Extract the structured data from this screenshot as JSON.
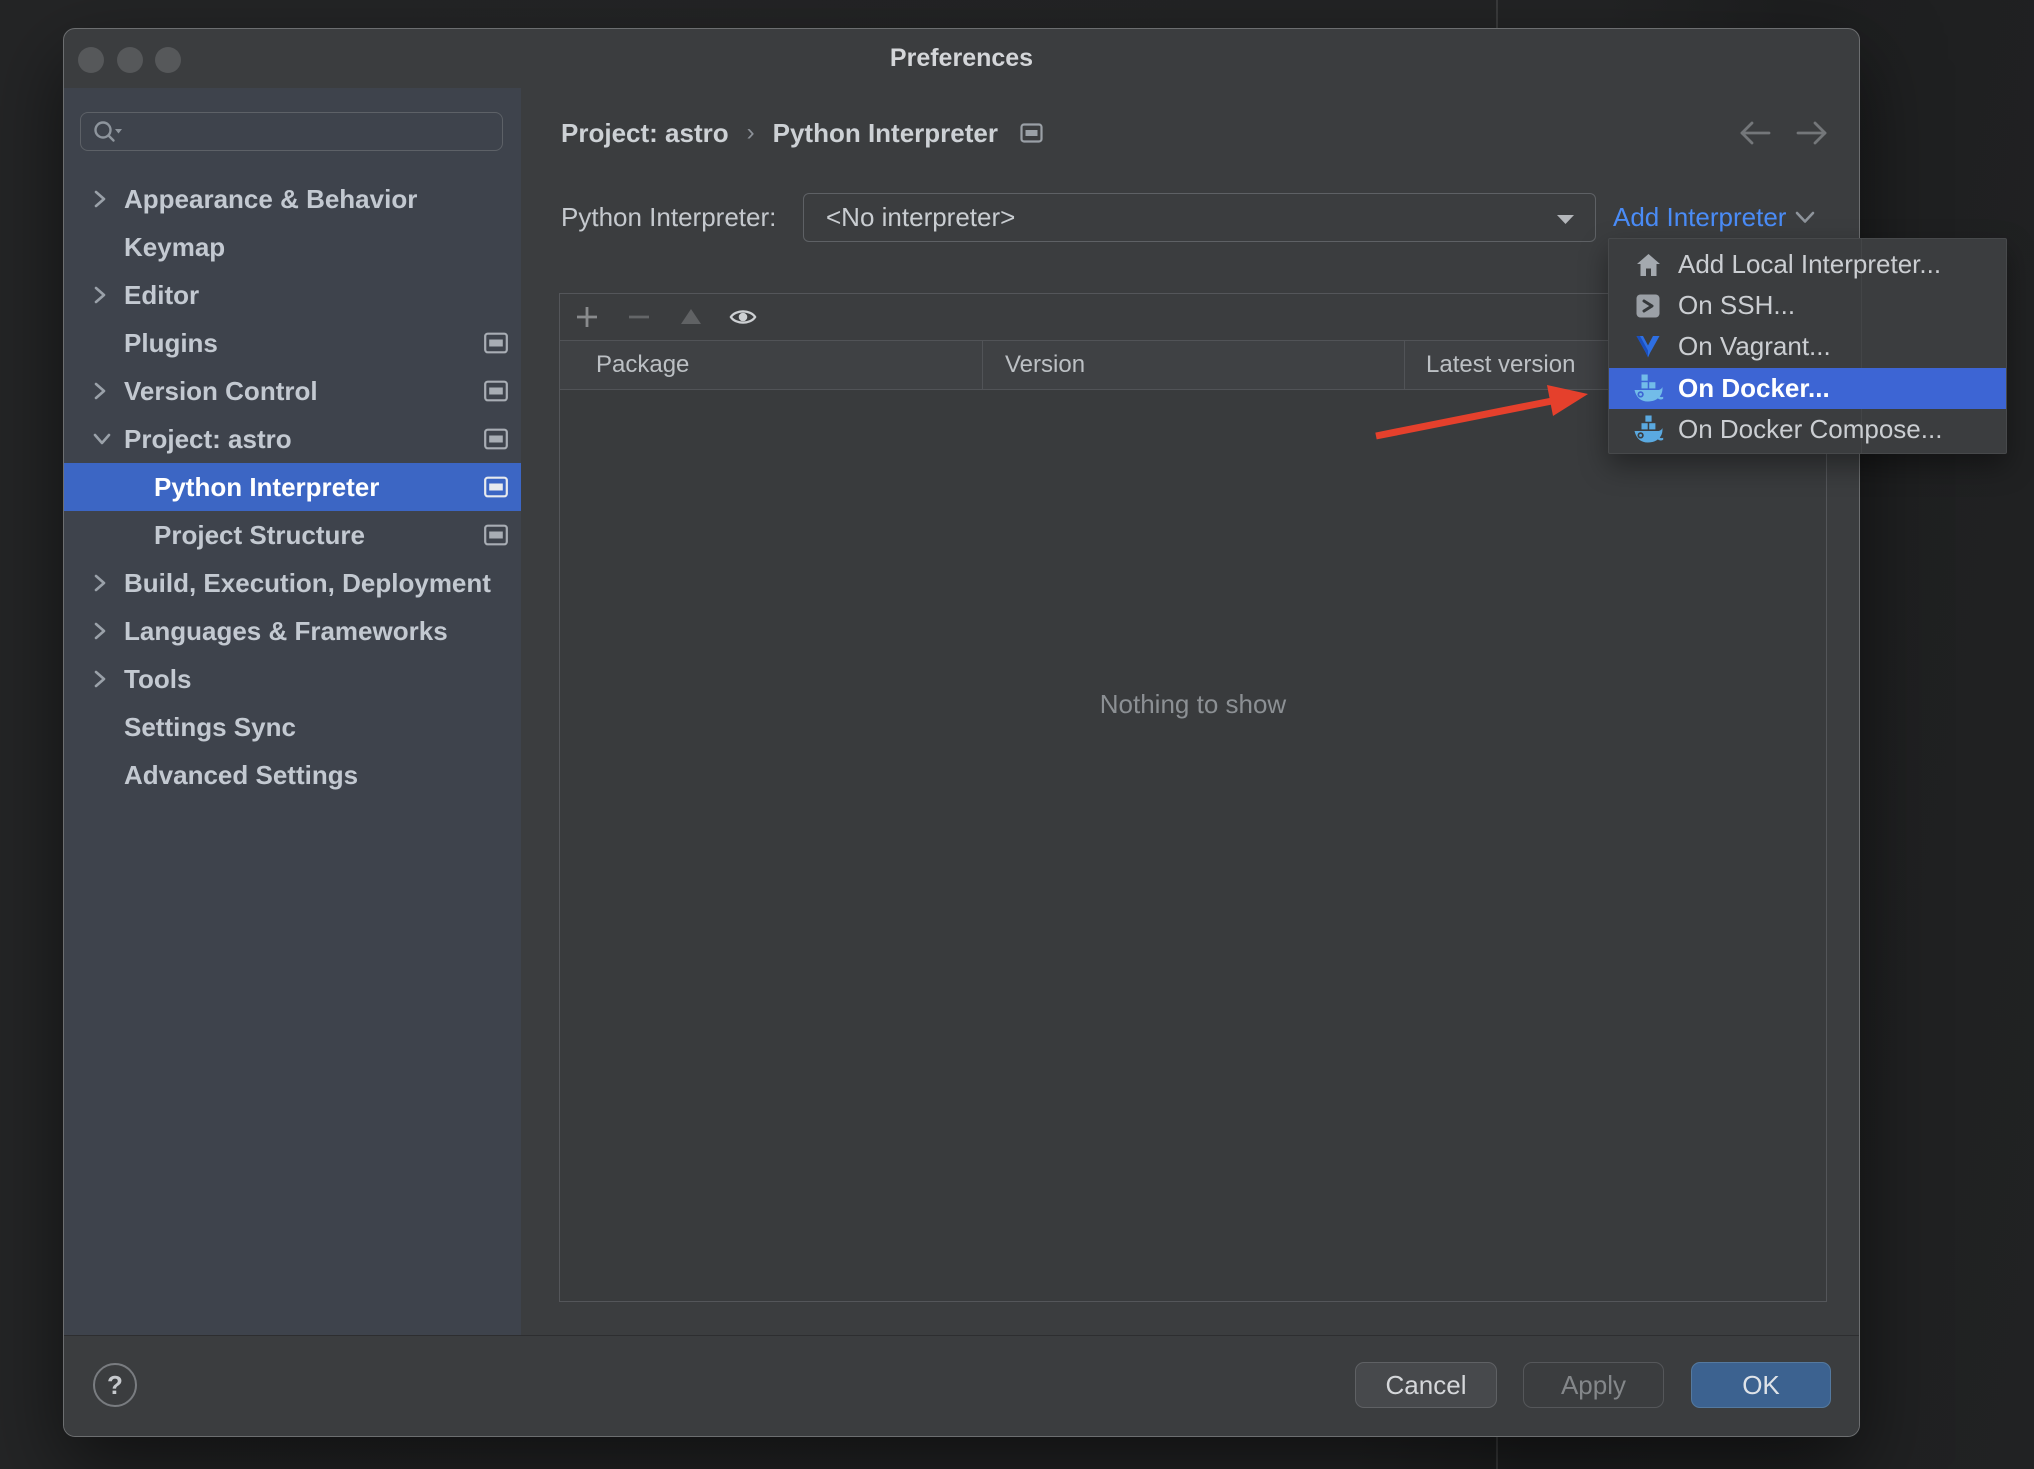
{
  "window": {
    "title": "Preferences"
  },
  "sidebar": {
    "search_placeholder": "",
    "items": [
      {
        "label": "Appearance & Behavior"
      },
      {
        "label": "Keymap"
      },
      {
        "label": "Editor"
      },
      {
        "label": "Plugins"
      },
      {
        "label": "Version Control"
      },
      {
        "label": "Project: astro"
      },
      {
        "label": "Python Interpreter"
      },
      {
        "label": "Project Structure"
      },
      {
        "label": "Build, Execution, Deployment"
      },
      {
        "label": "Languages & Frameworks"
      },
      {
        "label": "Tools"
      },
      {
        "label": "Settings Sync"
      },
      {
        "label": "Advanced Settings"
      }
    ]
  },
  "breadcrumb": {
    "project": "Project: astro",
    "separator": "›",
    "page": "Python Interpreter"
  },
  "interpreter": {
    "label": "Python Interpreter:",
    "value": "<No interpreter>",
    "add_link": "Add Interpreter"
  },
  "menu": {
    "items": [
      {
        "label": "Add Local Interpreter...",
        "icon": "home-icon"
      },
      {
        "label": "On SSH...",
        "icon": "ssh-icon"
      },
      {
        "label": "On Vagrant...",
        "icon": "vagrant-icon"
      },
      {
        "label": "On Docker...",
        "icon": "docker-icon"
      },
      {
        "label": "On Docker Compose...",
        "icon": "docker-compose-icon"
      }
    ]
  },
  "table": {
    "columns": [
      "Package",
      "Version",
      "Latest version"
    ],
    "empty_text": "Nothing to show"
  },
  "buttons": {
    "help": "?",
    "cancel": "Cancel",
    "apply": "Apply",
    "ok": "OK"
  },
  "colors": {
    "selection_blue": "#3c66c4",
    "menu_highlight_blue": "#3d65d4",
    "link_blue": "#4a8cf7",
    "ok_blue": "#3c6290",
    "arrow_red": "#e5402c",
    "sidebar_bg": "#3d434e",
    "window_bg": "#3b3d3f"
  }
}
